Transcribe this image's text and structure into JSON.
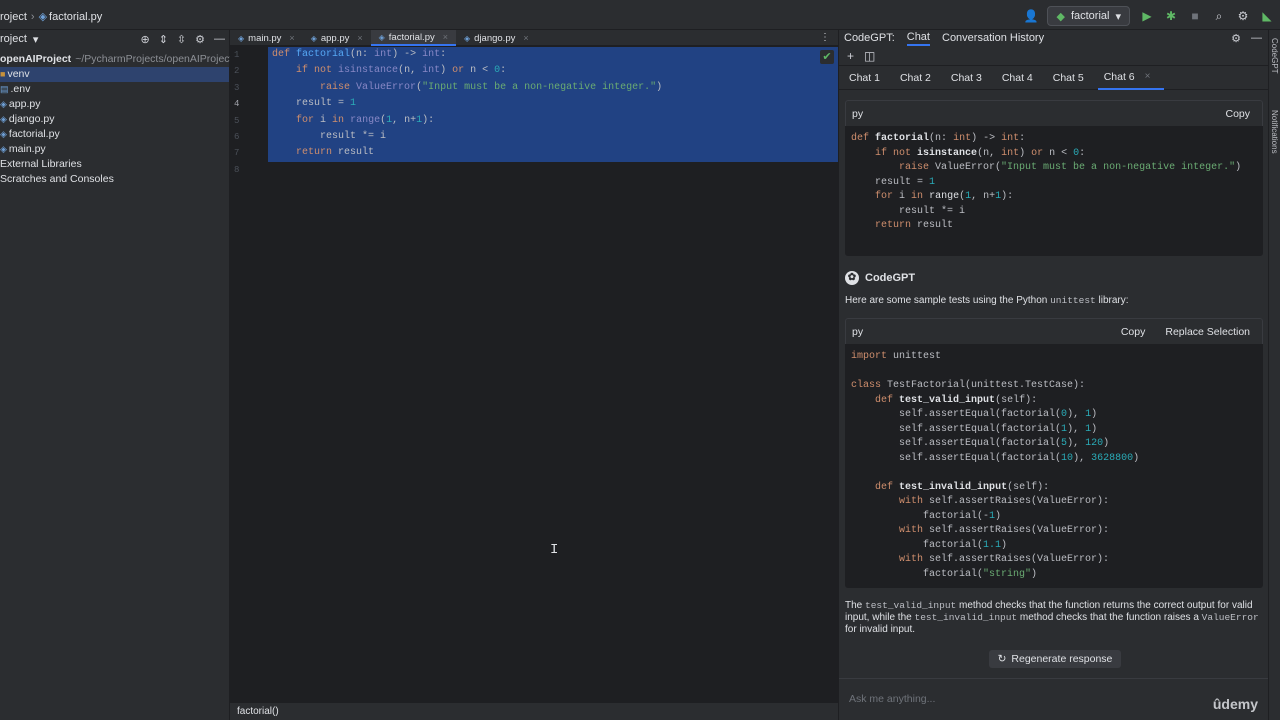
{
  "topbar": {
    "project_crumb": "roject",
    "file_crumb": "factorial.py",
    "run_config": "factorial"
  },
  "project": {
    "header_label": "roject",
    "tree": [
      {
        "label": "openAIProject",
        "path": "~/PycharmProjects/openAIProject",
        "icon": "project-folder-icon"
      },
      {
        "label": "venv",
        "icon": "folder-icon",
        "selected": true
      },
      {
        "label": ".env",
        "icon": "file-icon"
      },
      {
        "label": "app.py",
        "icon": "python-file-icon"
      },
      {
        "label": "django.py",
        "icon": "python-file-icon"
      },
      {
        "label": "factorial.py",
        "icon": "python-file-icon"
      },
      {
        "label": "main.py",
        "icon": "python-file-icon"
      },
      {
        "label": "External Libraries",
        "icon": "library-icon"
      },
      {
        "label": "Scratches and Consoles",
        "icon": "scratch-icon"
      }
    ]
  },
  "editor": {
    "tabs": [
      {
        "label": "main.py"
      },
      {
        "label": "app.py"
      },
      {
        "label": "factorial.py",
        "active": true
      },
      {
        "label": "django.py"
      }
    ],
    "line_numbers": [
      "1",
      "2",
      "3",
      "4",
      "5",
      "6",
      "7",
      "8"
    ],
    "breadcrumb_status": "factorial()"
  },
  "codegpt": {
    "title": "CodeGPT:",
    "tab_chat": "Chat",
    "tab_history": "Conversation History",
    "chat_tabs": [
      "Chat 1",
      "Chat 2",
      "Chat 3",
      "Chat 4",
      "Chat 5",
      "Chat 6"
    ],
    "active_chat": "Chat 6",
    "block1": {
      "lang": "py",
      "copy": "Copy"
    },
    "assistant_name": "CodeGPT",
    "intro_text_1": "Here are some sample tests using the Python ",
    "intro_code": "unittest",
    "intro_text_2": " library:",
    "block2": {
      "lang": "py",
      "copy": "Copy",
      "replace": "Replace Selection"
    },
    "outro": {
      "t1": "The ",
      "c1": "test_valid_input",
      "t2": " method checks that the function returns the correct output for valid input, while the ",
      "c2": "test_invalid_input",
      "t3": " method checks that the function raises a ",
      "c3": "ValueError",
      "t4": " for invalid input."
    },
    "regenerate": "Regenerate response",
    "ask_placeholder": "Ask me anything..."
  },
  "watermark": "ûdemy",
  "strip": {
    "top_label": "CodeGPT",
    "notifications_label": "Notifications"
  },
  "colors": {
    "selection": "#214283",
    "accent": "#3574f0",
    "keyword": "#cf8e6d",
    "function": "#56a8f5",
    "number": "#2aacb8",
    "string": "#6aab73"
  }
}
